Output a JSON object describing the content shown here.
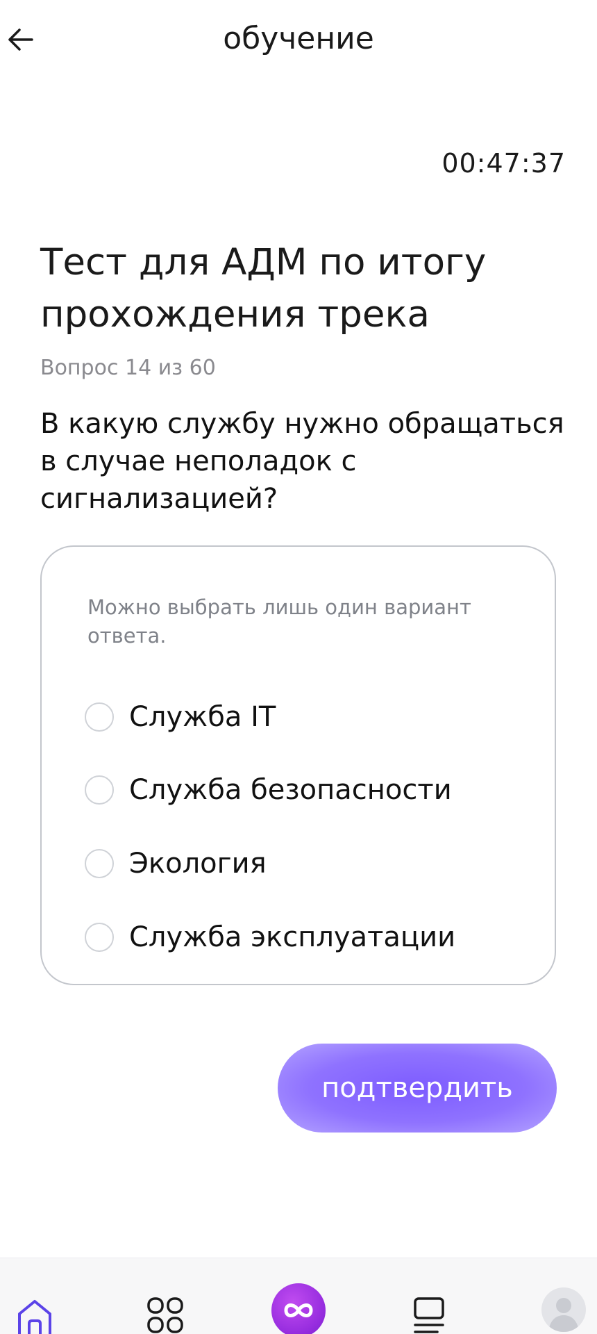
{
  "header": {
    "back_icon": "arrow-left-icon",
    "title": "обучение"
  },
  "timer": {
    "value": "00:47:37"
  },
  "test": {
    "title": "Тест для АДМ по итогу прохождения трека",
    "counter": "Вопрос 14 из 60",
    "question": "В какую службу нужно обращаться в случае неполадок с сигнализацией?"
  },
  "options_card": {
    "hint": "Можно выбрать лишь один вариант ответа.",
    "options": [
      {
        "label": "Служба IT"
      },
      {
        "label": "Служба безопасности"
      },
      {
        "label": "Экология"
      },
      {
        "label": "Служба эксплуатации"
      }
    ]
  },
  "confirm": {
    "label": "подтвердить"
  },
  "bottom_nav": {
    "items": [
      {
        "icon": "home-icon",
        "active": true
      },
      {
        "icon": "grid-icon",
        "active": false
      },
      {
        "icon": "infinity-icon",
        "active": false
      },
      {
        "icon": "list-icon",
        "active": false
      },
      {
        "icon": "avatar-icon",
        "active": false
      }
    ]
  },
  "colors": {
    "accent": "#7d5cff",
    "nav_active": "#5b43e8",
    "center_button": "#9a2fe0",
    "muted_text": "#8a8a8f",
    "card_border": "#c3c6cc"
  }
}
